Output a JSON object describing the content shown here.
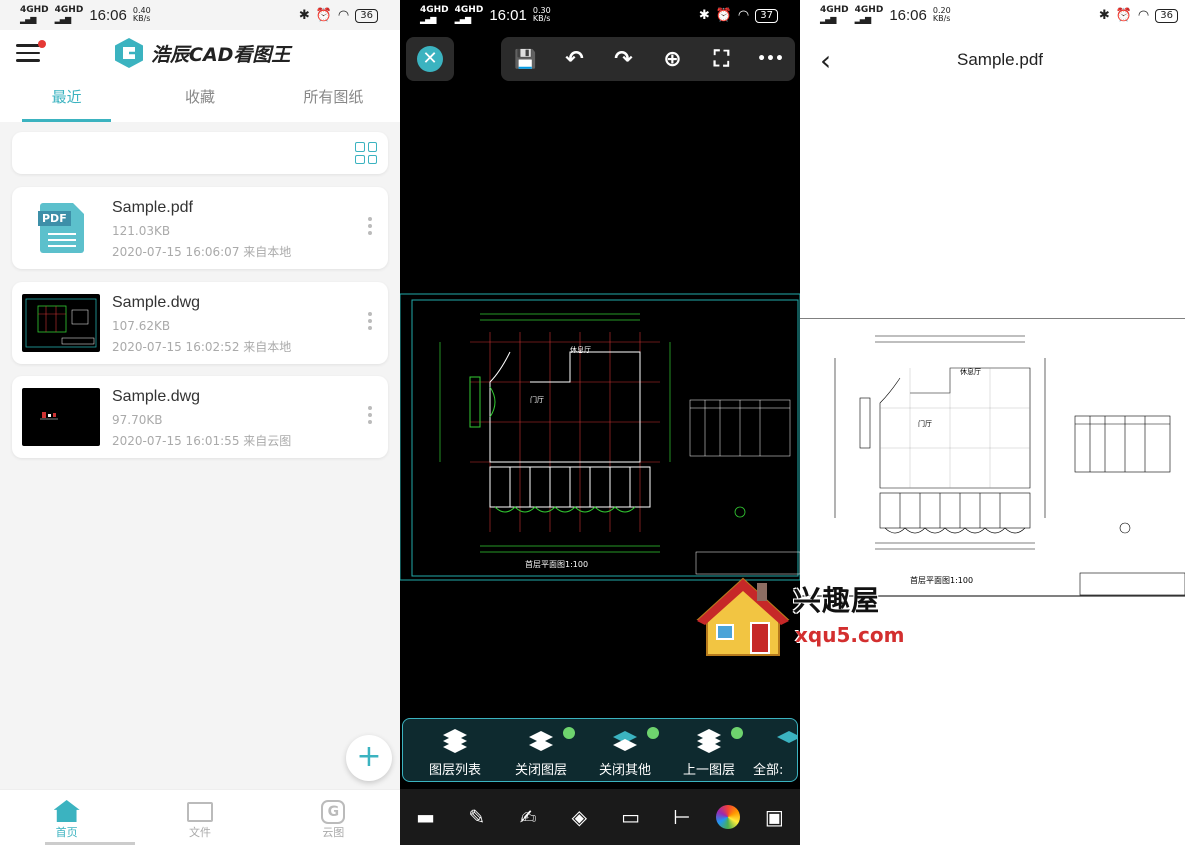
{
  "panel1": {
    "status": {
      "network": "4GHD",
      "time": "16:06",
      "speed": "0.40",
      "speed_unit": "KB/s",
      "battery": "36"
    },
    "app_title": "浩辰CAD看图王",
    "tabs": [
      {
        "label": "最近"
      },
      {
        "label": "收藏"
      },
      {
        "label": "所有图纸"
      }
    ],
    "files": [
      {
        "name": "Sample.pdf",
        "size": "121.03KB",
        "meta": "2020-07-15 16:06:07  来自本地",
        "type": "pdf"
      },
      {
        "name": "Sample.dwg",
        "size": "107.62KB",
        "meta": "2020-07-15 16:02:52  来自本地",
        "type": "dwg"
      },
      {
        "name": "Sample.dwg",
        "size": "97.70KB",
        "meta": "2020-07-15 16:01:55  来自云图",
        "type": "dwg"
      }
    ],
    "pdf_badge": "PDF",
    "fab_label": "+",
    "nav": [
      {
        "label": "首页"
      },
      {
        "label": "文件"
      },
      {
        "label": "云图"
      }
    ],
    "cloud_glyph": "G"
  },
  "panel2": {
    "status": {
      "network": "4GHD",
      "time": "16:01",
      "speed": "0.30",
      "speed_unit": "KB/s",
      "battery": "37"
    },
    "close_glyph": "✕",
    "toolbar_icons": [
      "save-icon",
      "undo-icon",
      "redo-icon",
      "zoom-icon",
      "fullscreen-icon",
      "more-icon"
    ],
    "toolbar_glyphs": [
      "💾",
      "↶",
      "↷",
      "⊕",
      "⛶",
      "•••"
    ],
    "drawing_title": "首层平面图1:100",
    "drawing_room1": "休息厅",
    "drawing_room2": "门厅",
    "layer_actions": [
      {
        "label": "图层列表"
      },
      {
        "label": "关闭图层"
      },
      {
        "label": "关闭其他"
      },
      {
        "label": "上一图层"
      },
      {
        "label": "全部:"
      }
    ],
    "bottom_tools": [
      "comment-icon",
      "pen-icon",
      "edit-icon",
      "layers-icon",
      "ruler-icon",
      "dimension-icon",
      "color-wheel-icon",
      "toolbox-icon"
    ],
    "bottom_glyphs": [
      "▬",
      "✎",
      "✍",
      "◈",
      "▭",
      "⊢",
      "",
      "▣"
    ]
  },
  "panel3": {
    "status": {
      "network": "4GHD",
      "time": "16:06",
      "speed": "0.20",
      "speed_unit": "KB/s",
      "battery": "36"
    },
    "title": "Sample.pdf",
    "back_glyph": "‹",
    "drawing_title": "首层平面图1:100",
    "drawing_room1": "休息厅",
    "drawing_room2": "门厅"
  },
  "watermark": {
    "text": "兴趣屋",
    "url": "xqu5.com"
  },
  "colors": {
    "accent": "#3bb3c0",
    "cad_green": "#33cc33",
    "cad_red": "#cc3333",
    "cad_cyan": "#33aaaa"
  }
}
